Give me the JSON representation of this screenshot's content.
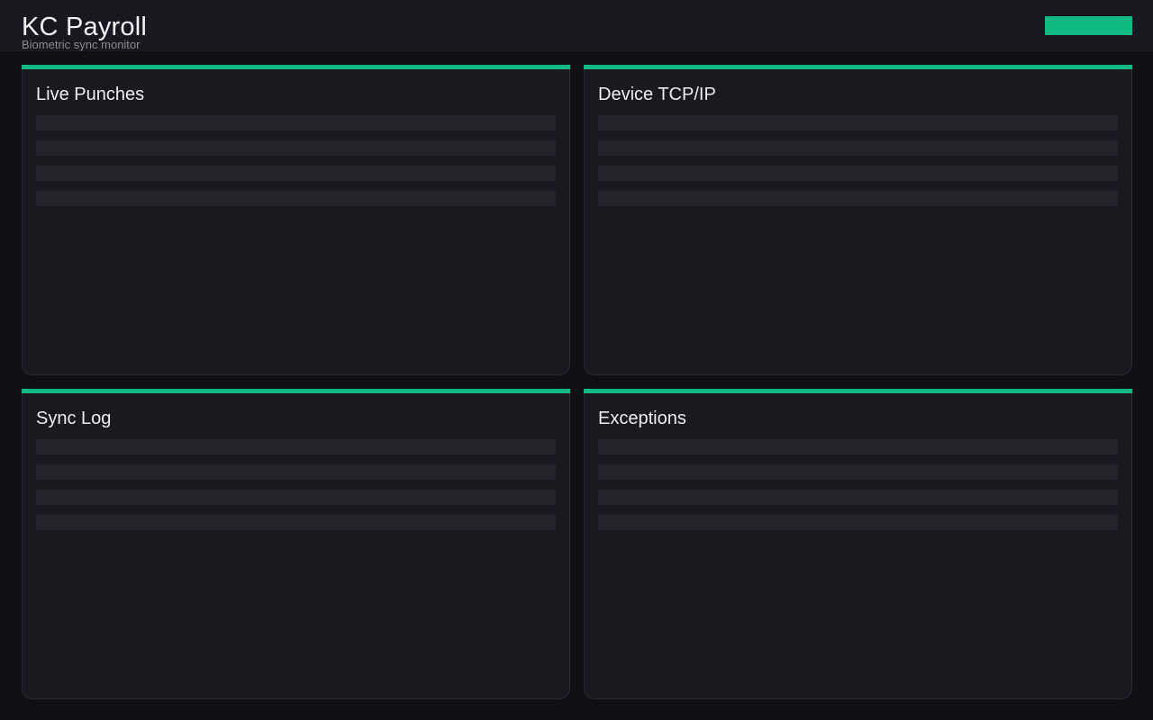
{
  "header": {
    "title": "KC Payroll",
    "subtitle": "Biometric sync monitor",
    "action_label": ""
  },
  "colors": {
    "accent": "#10b981",
    "background": "#0f1014",
    "panel": "#191920",
    "skeleton": "#24242f"
  },
  "panels": [
    {
      "title": "Live Punches"
    },
    {
      "title": "Device TCP/IP"
    },
    {
      "title": "Sync Log"
    },
    {
      "title": "Exceptions"
    }
  ]
}
